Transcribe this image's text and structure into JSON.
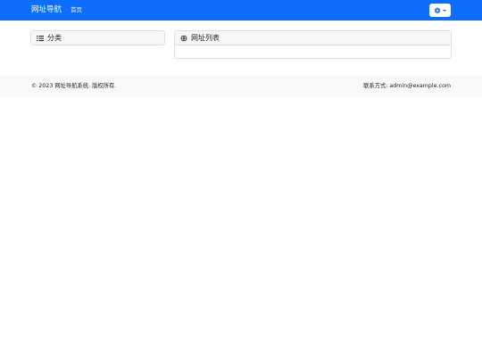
{
  "navbar": {
    "brand": "网址导航",
    "links": [
      "首页"
    ],
    "settings_icon": "gear-icon",
    "colors": {
      "background": "#0d6efd",
      "text": "#ffffff"
    }
  },
  "sidebar": {
    "title": "分类",
    "icon": "list-icon"
  },
  "main": {
    "title": "网址列表",
    "icon": "globe-icon"
  },
  "footer": {
    "copyright": "© 2023 网址导航系统. 版权所有.",
    "contact": "联系方式: admin@example.com"
  }
}
